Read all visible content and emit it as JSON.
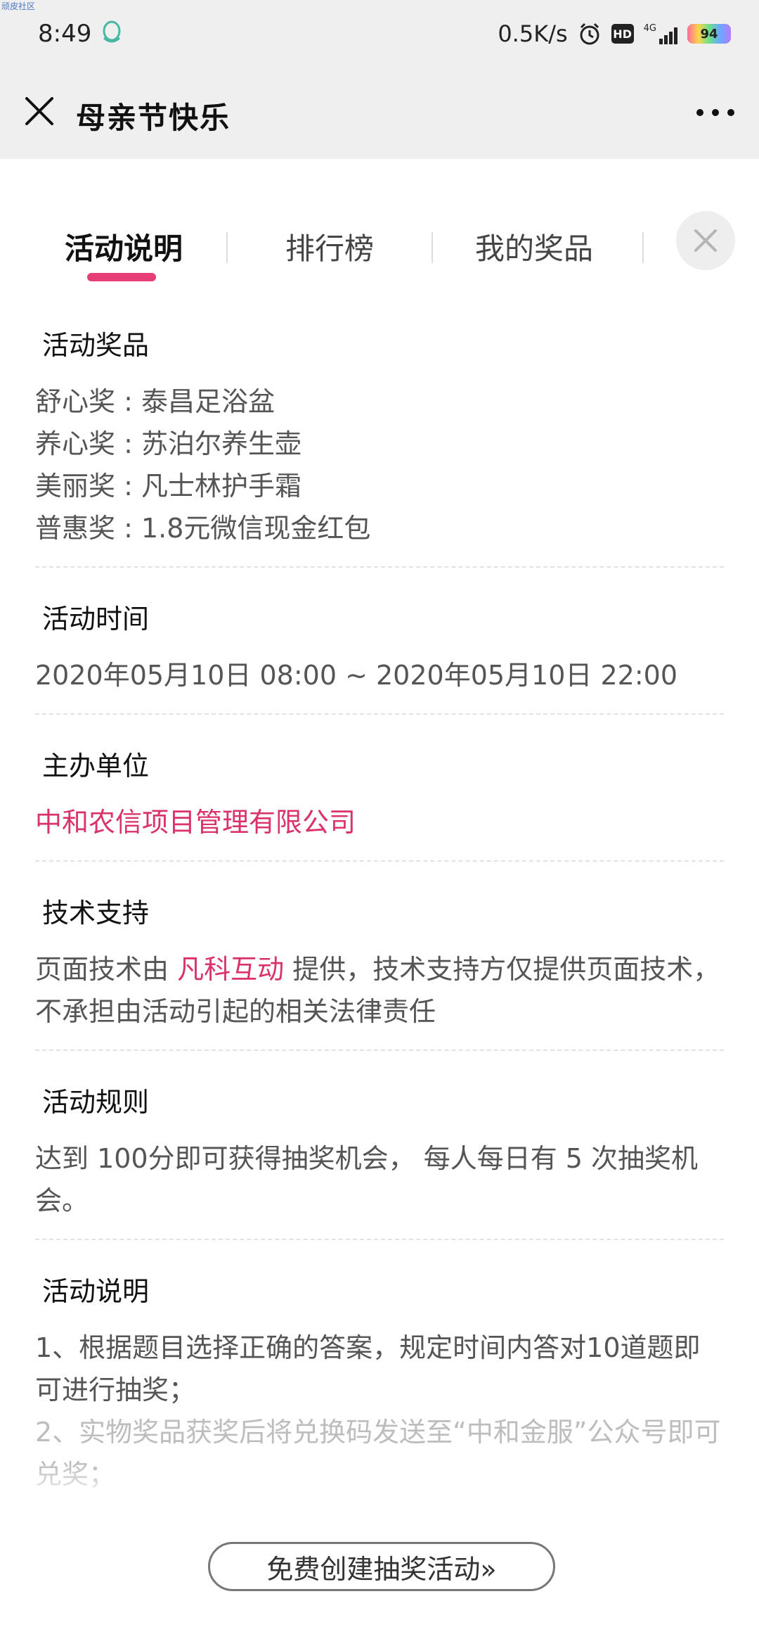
{
  "status": {
    "watermark": "顽皮社区",
    "time": "8:49",
    "net_speed": "0.5K/s",
    "hd": "HD",
    "signal": "4G",
    "battery": "94"
  },
  "header": {
    "title": "母亲节快乐"
  },
  "tabs": [
    {
      "label": "活动说明",
      "active": true
    },
    {
      "label": "排行榜",
      "active": false
    },
    {
      "label": "我的奖品",
      "active": false
    }
  ],
  "sections": {
    "prizes": {
      "title": "活动奖品",
      "lines": [
        "舒心奖 : 泰昌足浴盆",
        "养心奖 : 苏泊尔养生壶",
        "美丽奖 : 凡士林护手霜",
        "普惠奖 : 1.8元微信现金红包"
      ]
    },
    "time": {
      "title": "活动时间",
      "value": "2020年05月10日 08:00 ~ 2020年05月10日 22:00"
    },
    "organizer": {
      "title": "主办单位",
      "value": "中和农信项目管理有限公司"
    },
    "tech": {
      "title": "技术支持",
      "pre": "页面技术由 ",
      "link": "凡科互动",
      "post": " 提供，技术支持方仅提供页面技术，不承担由活动引起的相关法律责任"
    },
    "rules": {
      "title": "活动规则",
      "value": "达到 100分即可获得抽奖机会， 每人每日有 5 次抽奖机会。"
    },
    "desc": {
      "title": "活动说明",
      "line1": "1、根据题目选择正确的答案，规定时间内答对10道题即可进行抽奖；",
      "line2": "2、实物奖品获奖后将兑换码发送至“中和金服”公众号即可兑奖；"
    }
  },
  "footer": {
    "button_label": "免费创建抽奖活动»"
  },
  "colors": {
    "accent": "#e83e78",
    "link": "#d9336a"
  }
}
